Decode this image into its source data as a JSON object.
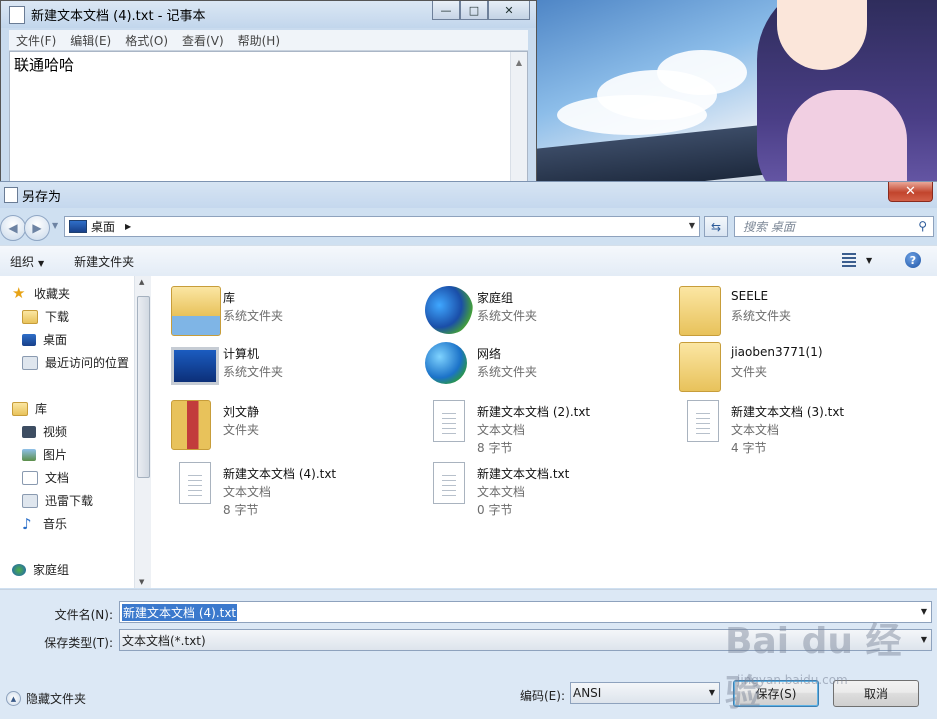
{
  "notepad": {
    "title": "新建文本文档 (4).txt - 记事本",
    "menu": [
      "文件(F)",
      "编辑(E)",
      "格式(O)",
      "查看(V)",
      "帮助(H)"
    ],
    "content": "联通哈哈"
  },
  "dialog": {
    "title": "另存为",
    "address": {
      "location": "桌面"
    },
    "search_placeholder": "搜索 桌面",
    "toolbar": {
      "organize": "组织",
      "new_folder": "新建文件夹"
    },
    "nav": {
      "favorites": "收藏夹",
      "fav_items": [
        "下载",
        "桌面",
        "最近访问的位置"
      ],
      "libraries": "库",
      "lib_items": [
        "视频",
        "图片",
        "文档",
        "迅雷下载",
        "音乐"
      ],
      "homegroup": "家庭组"
    },
    "files": [
      {
        "name": "库",
        "type": "系统文件夹",
        "size": "",
        "icon": "library-icon"
      },
      {
        "name": "家庭组",
        "type": "系统文件夹",
        "size": "",
        "icon": "homegroup-icon"
      },
      {
        "name": "SEELE",
        "type": "系统文件夹",
        "size": "",
        "icon": "user-folder-icon"
      },
      {
        "name": "计算机",
        "type": "系统文件夹",
        "size": "",
        "icon": "computer-icon"
      },
      {
        "name": "网络",
        "type": "系统文件夹",
        "size": "",
        "icon": "network-icon"
      },
      {
        "name": "jiaoben3771(1)",
        "type": "文件夹",
        "size": "",
        "icon": "folder-icon"
      },
      {
        "name": "刘文静",
        "type": "文件夹",
        "size": "",
        "icon": "folder-icon"
      },
      {
        "name": "新建文本文档 (2).txt",
        "type": "文本文档",
        "size": "8 字节",
        "icon": "text-file-icon"
      },
      {
        "name": "新建文本文档 (3).txt",
        "type": "文本文档",
        "size": "4 字节",
        "icon": "text-file-icon"
      },
      {
        "name": "新建文本文档 (4).txt",
        "type": "文本文档",
        "size": "8 字节",
        "icon": "text-file-icon"
      },
      {
        "name": "新建文本文档.txt",
        "type": "文本文档",
        "size": "0 字节",
        "icon": "text-file-icon"
      }
    ],
    "filename_label": "文件名(N):",
    "filename_value": "新建文本文档 (4).txt",
    "savetype_label": "保存类型(T):",
    "savetype_value": "文本文档(*.txt)",
    "hide_folders": "隐藏文件夹",
    "encoding_label": "编码(E):",
    "encoding_value": "ANSI",
    "save_button": "保存(S)",
    "cancel_button": "取消"
  },
  "watermark": {
    "main": "Bai du 经验",
    "sub": "jingyan.baidu.com"
  }
}
